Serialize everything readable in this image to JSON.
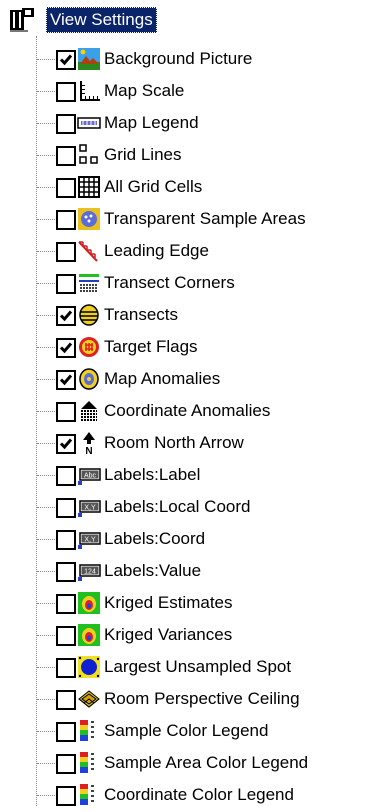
{
  "tree": {
    "root": {
      "label": "View Settings",
      "icon": "book-icon",
      "selected": true
    },
    "items": [
      {
        "label": "Background Picture",
        "checked": true,
        "icon": "background-picture-icon"
      },
      {
        "label": "Map Scale",
        "checked": false,
        "icon": "ruler-icon"
      },
      {
        "label": "Map Legend",
        "checked": false,
        "icon": "legend-icon"
      },
      {
        "label": "Grid Lines",
        "checked": false,
        "icon": "grid-lines-icon"
      },
      {
        "label": "All Grid Cells",
        "checked": false,
        "icon": "grid-cells-icon"
      },
      {
        "label": "Transparent Sample Areas",
        "checked": false,
        "icon": "sample-area-icon"
      },
      {
        "label": "Leading Edge",
        "checked": false,
        "icon": "leading-edge-icon"
      },
      {
        "label": "Transect Corners",
        "checked": false,
        "icon": "transect-corners-icon"
      },
      {
        "label": "Transects",
        "checked": true,
        "icon": "transects-icon"
      },
      {
        "label": "Target Flags",
        "checked": true,
        "icon": "target-flags-icon"
      },
      {
        "label": "Map Anomalies",
        "checked": true,
        "icon": "map-anomalies-icon"
      },
      {
        "label": "Coordinate Anomalies",
        "checked": false,
        "icon": "coordinate-anomalies-icon"
      },
      {
        "label": "Room North Arrow",
        "checked": true,
        "icon": "north-arrow-icon"
      },
      {
        "label": "Labels:Label",
        "checked": false,
        "icon": "label-abc-icon"
      },
      {
        "label": "Labels:Local Coord",
        "checked": false,
        "icon": "label-xy-icon"
      },
      {
        "label": "Labels:Coord",
        "checked": false,
        "icon": "label-xy-icon"
      },
      {
        "label": "Labels:Value",
        "checked": false,
        "icon": "label-value-icon"
      },
      {
        "label": "Kriged Estimates",
        "checked": false,
        "icon": "kriged-icon"
      },
      {
        "label": "Kriged Variances",
        "checked": false,
        "icon": "kriged-icon"
      },
      {
        "label": "Largest Unsampled Spot",
        "checked": false,
        "icon": "unsampled-spot-icon"
      },
      {
        "label": "Room Perspective Ceiling",
        "checked": false,
        "icon": "perspective-ceiling-icon"
      },
      {
        "label": "Sample Color Legend",
        "checked": false,
        "icon": "color-legend-icon"
      },
      {
        "label": "Sample Area Color Legend",
        "checked": false,
        "icon": "color-legend-icon"
      },
      {
        "label": "Coordinate Color Legend",
        "checked": false,
        "icon": "color-legend-icon"
      }
    ]
  }
}
